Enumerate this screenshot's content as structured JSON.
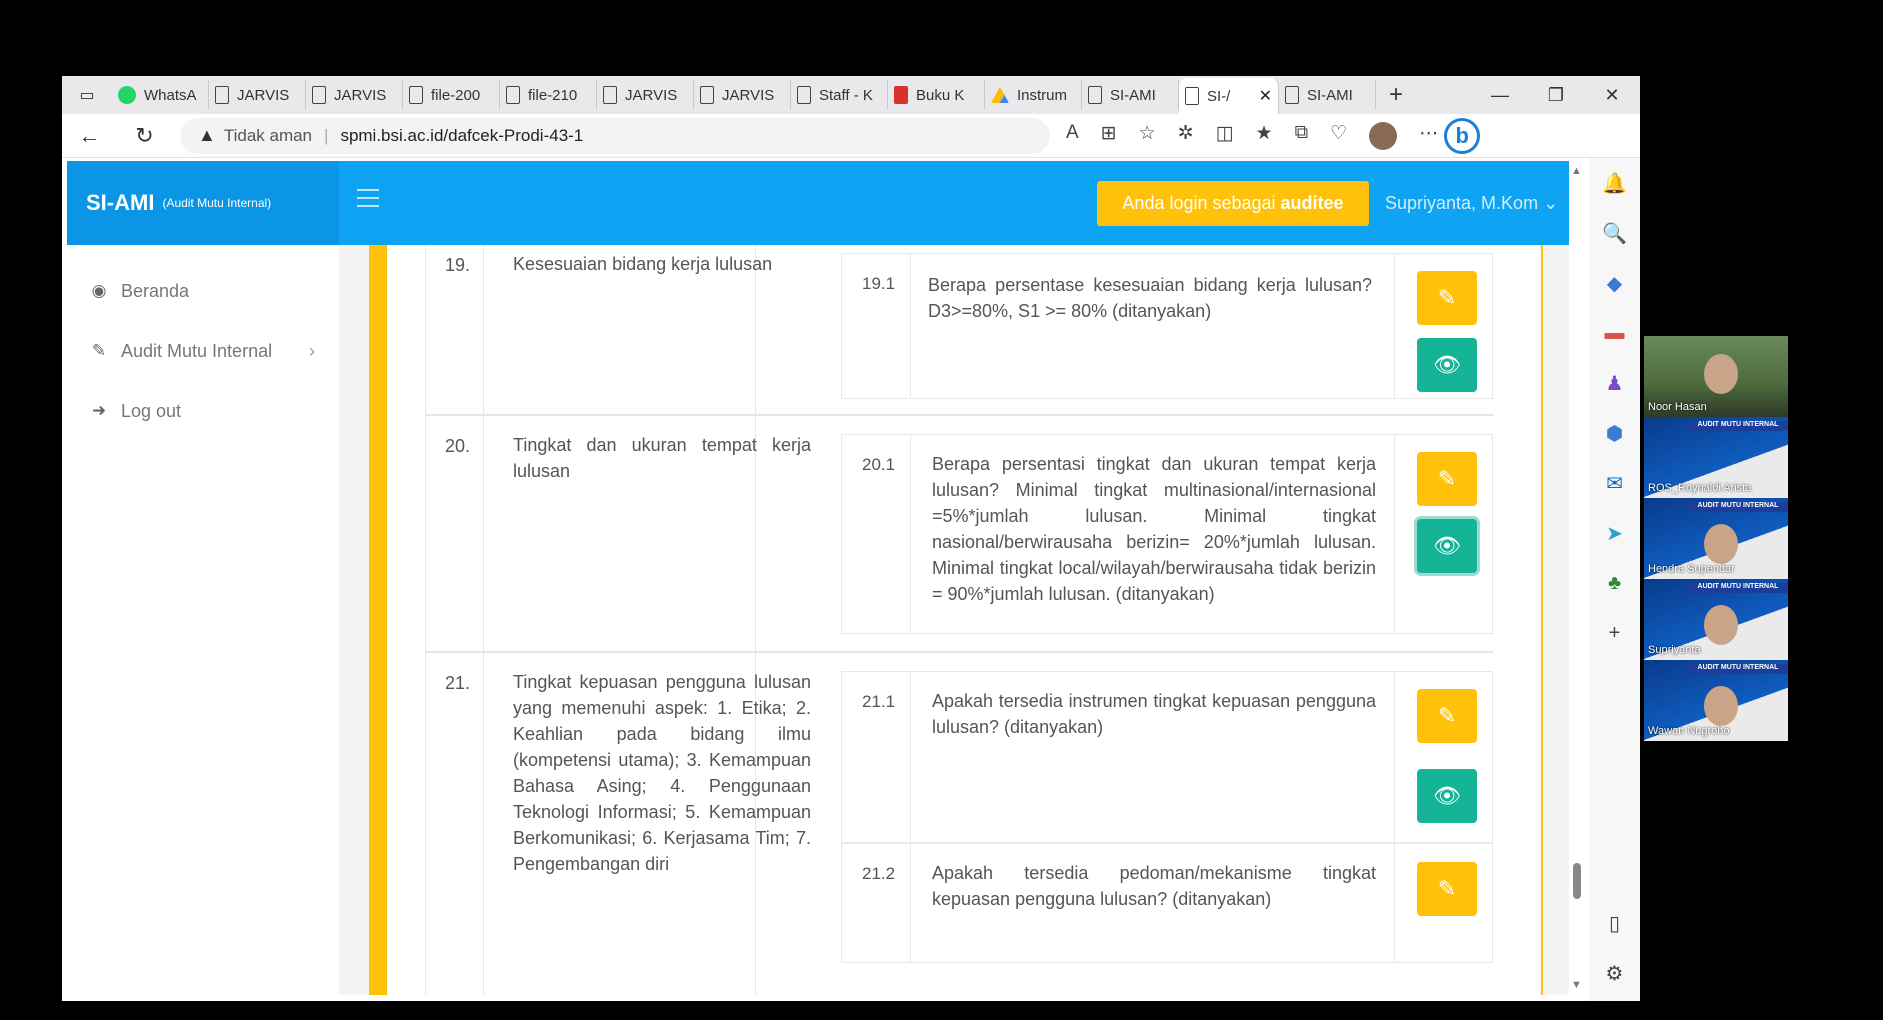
{
  "browser": {
    "tabs": [
      {
        "label": "WhatsA",
        "icon": "whatsapp-icon"
      },
      {
        "label": "JARVIS",
        "icon": "page-icon"
      },
      {
        "label": "JARVIS",
        "icon": "page-icon"
      },
      {
        "label": "file-200",
        "icon": "page-icon"
      },
      {
        "label": "file-210",
        "icon": "page-icon"
      },
      {
        "label": "JARVIS",
        "icon": "page-icon"
      },
      {
        "label": "JARVIS",
        "icon": "page-icon"
      },
      {
        "label": "Staff - K",
        "icon": "page-icon"
      },
      {
        "label": "Buku K",
        "icon": "pdf-icon"
      },
      {
        "label": "Instrum",
        "icon": "drive-icon"
      },
      {
        "label": "SI-AMI",
        "icon": "page-icon"
      },
      {
        "label": "SI-/",
        "icon": "page-icon",
        "active": true
      },
      {
        "label": "SI-AMI",
        "icon": "page-icon"
      }
    ],
    "security_label": "Tidak aman",
    "url": "spmi.bsi.ac.id/dafcek-Prodi-43-1"
  },
  "app": {
    "brand_title": "SI-AMI",
    "brand_subtitle": "(Audit Mutu Internal)",
    "login_prefix": "Anda login sebagai",
    "login_role": "auditee",
    "user_name": "Supriyanta, M.Kom"
  },
  "sidebar": {
    "items": [
      {
        "label": "Beranda",
        "icon": "dashboard-icon"
      },
      {
        "label": "Audit Mutu Internal",
        "icon": "edit-icon"
      },
      {
        "label": "Log out",
        "icon": "logout-icon"
      }
    ]
  },
  "rows": [
    {
      "no": "19.",
      "criterion": "Kesesuaian bidang kerja lulusan",
      "questions": [
        {
          "code": "19.1",
          "text": "Berapa persentase kesesuaian bidang kerja lulusan? D3>=80%, S1 >= 80% (ditanyakan)"
        }
      ]
    },
    {
      "no": "20.",
      "criterion": "Tingkat dan ukuran tempat kerja lulusan",
      "questions": [
        {
          "code": "20.1",
          "text": "Berapa persentasi tingkat dan ukuran tempat kerja lulusan? Minimal tingkat multinasional/internasional =5%*jumlah lulusan. Minimal tingkat nasional/berwirausaha berizin= 20%*jumlah lulusan. Minimal tingkat local/wilayah/berwirausaha tidak berizin = 90%*jumlah lulusan. (ditanyakan)"
        }
      ]
    },
    {
      "no": "21.",
      "criterion": "Tingkat kepuasan pengguna lulusan yang memenuhi aspek: 1. Etika; 2. Keahlian pada bidang ilmu (kompetensi utama); 3. Kemampuan Bahasa Asing; 4. Penggunaan Teknologi Informasi; 5. Kemampuan Berkomunikasi; 6. Kerjasama Tim; 7. Pengembangan diri",
      "questions": [
        {
          "code": "21.1",
          "text": "Apakah tersedia instrumen tingkat kepuasan pengguna lulusan? (ditanyakan)"
        },
        {
          "code": "21.2",
          "text": "Apakah tersedia pedoman/mekanisme tingkat kepuasan pengguna lulusan? (ditanyakan)"
        }
      ]
    }
  ],
  "participants": [
    {
      "name": "Noor Hasan"
    },
    {
      "name": "ROS_Roynaldi Arista"
    },
    {
      "name": "Hendra Supendar"
    },
    {
      "name": "Supriyanta"
    },
    {
      "name": "Wawan Nugroho"
    }
  ],
  "tile_banner": "AUDIT MUTU INTERNAL",
  "colors": {
    "header": "#0fa3f3",
    "accent_yellow": "#ffc10a",
    "view_green": "#16b497"
  }
}
